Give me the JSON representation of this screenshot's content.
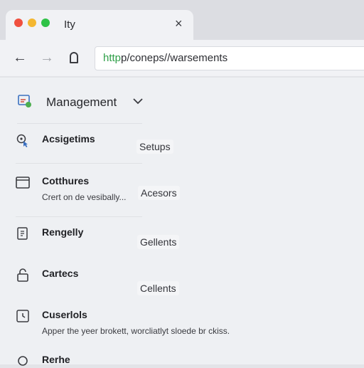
{
  "tab": {
    "title": "Ity",
    "close": "×"
  },
  "toolbar": {
    "back": "←",
    "forward": "→",
    "url_scheme": "http",
    "url_rest": "p/coneps//warsements"
  },
  "management": {
    "label": "Management"
  },
  "items": [
    {
      "label": "Acsigetims",
      "desc": ""
    },
    {
      "label": "Cotthures",
      "desc": "Crert on de vesibally..."
    },
    {
      "label": "Rengelly",
      "desc": ""
    },
    {
      "label": "Cartecs",
      "desc": ""
    },
    {
      "label": "Cuserlols",
      "desc": "Apper the yeer brokett, worcliatlyt sloede br ckiss."
    },
    {
      "label": "Rerhe",
      "desc": ""
    }
  ],
  "chips": [
    {
      "label": "Setups"
    },
    {
      "label": "Acesors"
    },
    {
      "label": "Gellents"
    },
    {
      "label": "Cellents"
    }
  ],
  "colors": {
    "accent_green": "#2f9f48",
    "close_red": "#f0503f",
    "minimize_yellow": "#f4b731",
    "maximize_green": "#2fc247"
  }
}
